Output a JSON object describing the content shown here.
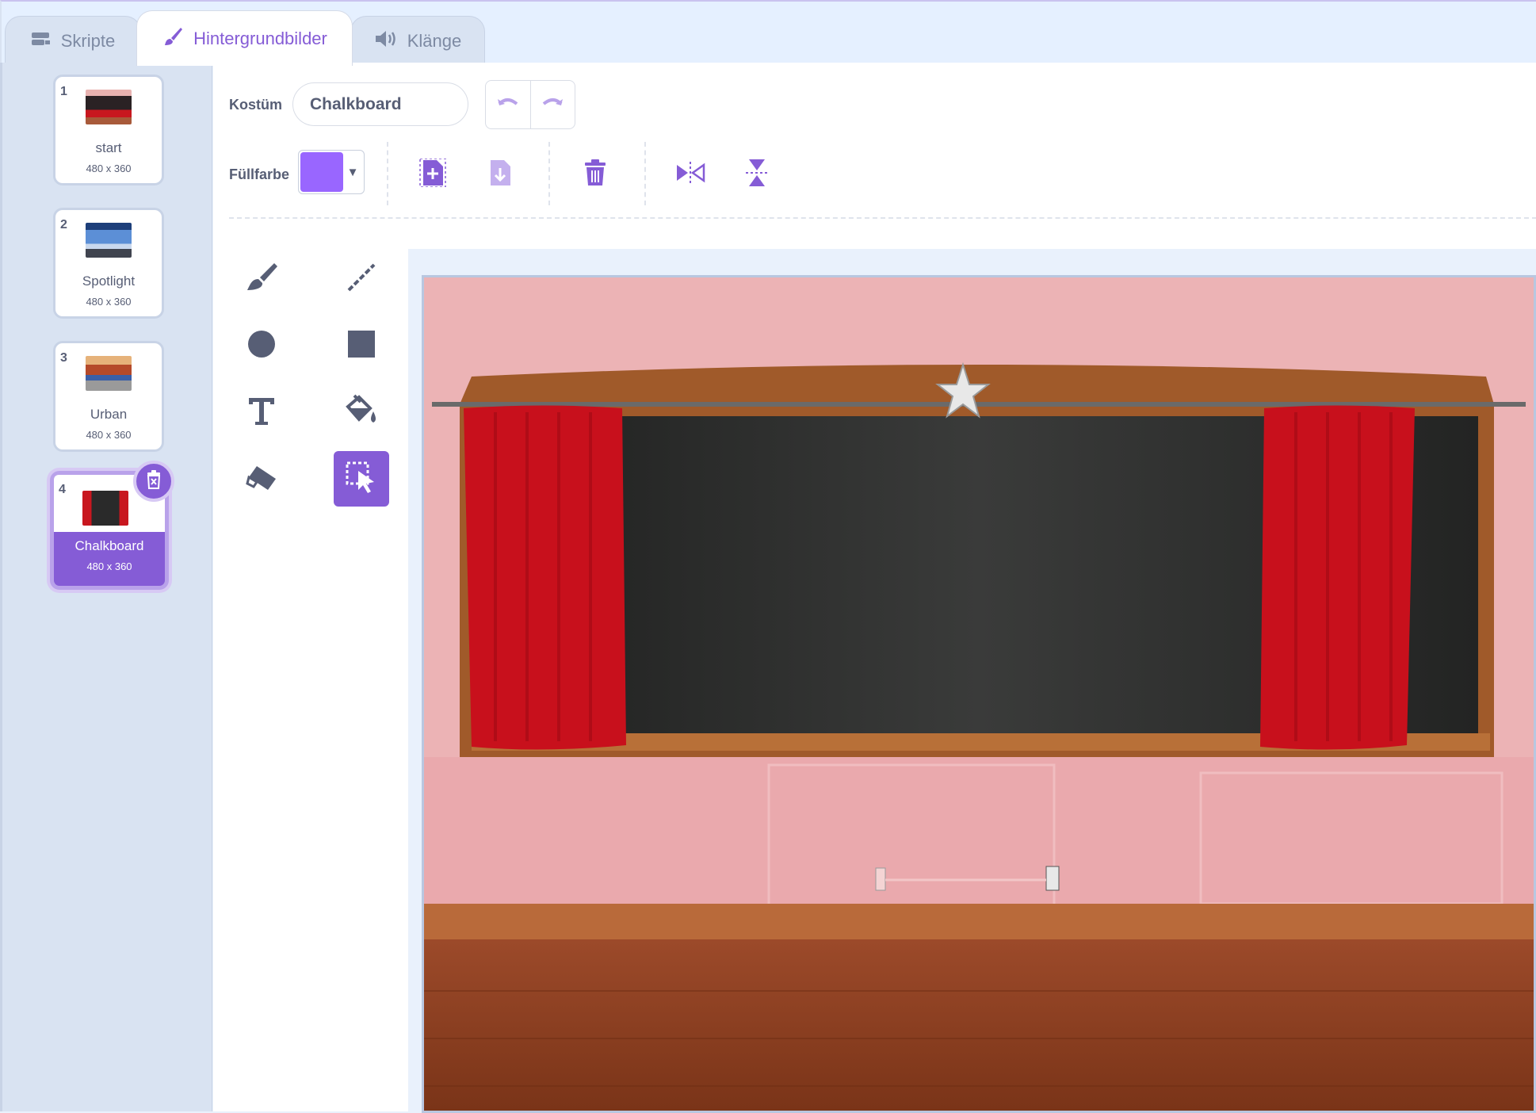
{
  "tabs": {
    "code": "Skripte",
    "backdrops": "Hintergrundbilder",
    "sounds": "Klänge"
  },
  "backdrops": [
    {
      "number": "1",
      "name": "start",
      "size": "480 x 360"
    },
    {
      "number": "2",
      "name": "Spotlight",
      "size": "480 x 360"
    },
    {
      "number": "3",
      "name": "Urban",
      "size": "480 x 360"
    },
    {
      "number": "4",
      "name": "Chalkboard",
      "size": "480 x 360",
      "selected": true
    }
  ],
  "editor": {
    "costume_label": "Kostüm",
    "costume_name": "Chalkboard",
    "fill_label": "Füllfarbe",
    "fill_color": "#9966ff"
  },
  "colors": {
    "accent": "#855cd6",
    "icon": "#575e75"
  },
  "icons": [
    "code-icon",
    "paintbrush-icon",
    "speaker-icon",
    "undo-icon",
    "redo-icon",
    "group-icon",
    "ungroup-icon",
    "trash-icon",
    "flip-horizontal-icon",
    "flip-vertical-icon",
    "brush-tool-icon",
    "line-tool-icon",
    "circle-tool-icon",
    "rectangle-tool-icon",
    "text-tool-icon",
    "fill-tool-icon",
    "eraser-tool-icon",
    "select-tool-icon"
  ]
}
